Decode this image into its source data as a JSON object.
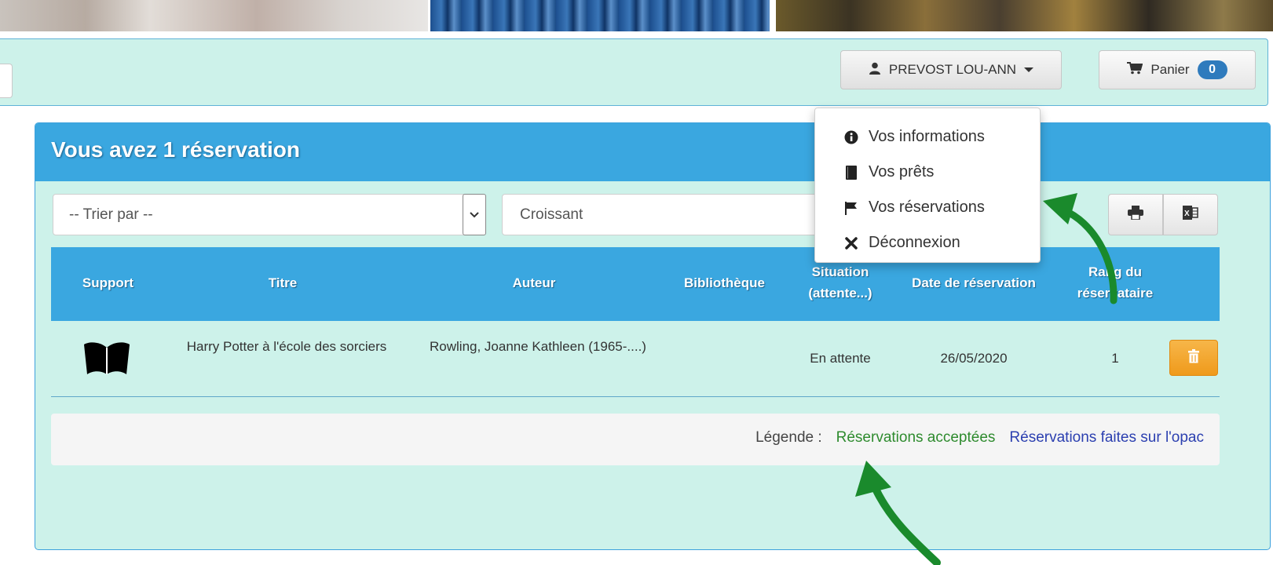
{
  "header": {
    "user_name": "PREVOST LOU-ANN",
    "cart_label": "Panier",
    "cart_count": "0"
  },
  "user_menu": {
    "items": [
      {
        "label": "Vos informations",
        "icon": "info-circle-icon"
      },
      {
        "label": "Vos prêts",
        "icon": "book-icon"
      },
      {
        "label": "Vos réservations",
        "icon": "flag-icon"
      },
      {
        "label": "Déconnexion",
        "icon": "close-x-icon"
      }
    ]
  },
  "panel": {
    "title": "Vous avez 1 réservation",
    "sort_placeholder": "-- Trier par --",
    "order_value": "Croissant"
  },
  "table": {
    "headers": [
      "Support",
      "Titre",
      "Auteur",
      "Bibliothèque",
      "Situation (attente...)",
      "Date de réservation",
      "Rang du réservataire"
    ],
    "rows": [
      {
        "support_icon": "book-open-icon",
        "titre": "Harry Potter à l'école des sorciers",
        "auteur": "Rowling, Joanne Kathleen (1965-....)",
        "bibliotheque": "",
        "situation": "En attente",
        "date": "26/05/2020",
        "rang": "1"
      }
    ]
  },
  "legend": {
    "label": "Légende :",
    "accepted": "Réservations acceptées",
    "opac": "Réservations faites sur l'opac"
  },
  "colors": {
    "accent_blue": "#3aa7e0",
    "panel_bg": "#cdf2ea",
    "accepted_green": "#2e8b2e",
    "opac_blue": "#2b3fb0",
    "delete_orange": "#f0a12a",
    "annotation_green": "#1a8a2c"
  }
}
